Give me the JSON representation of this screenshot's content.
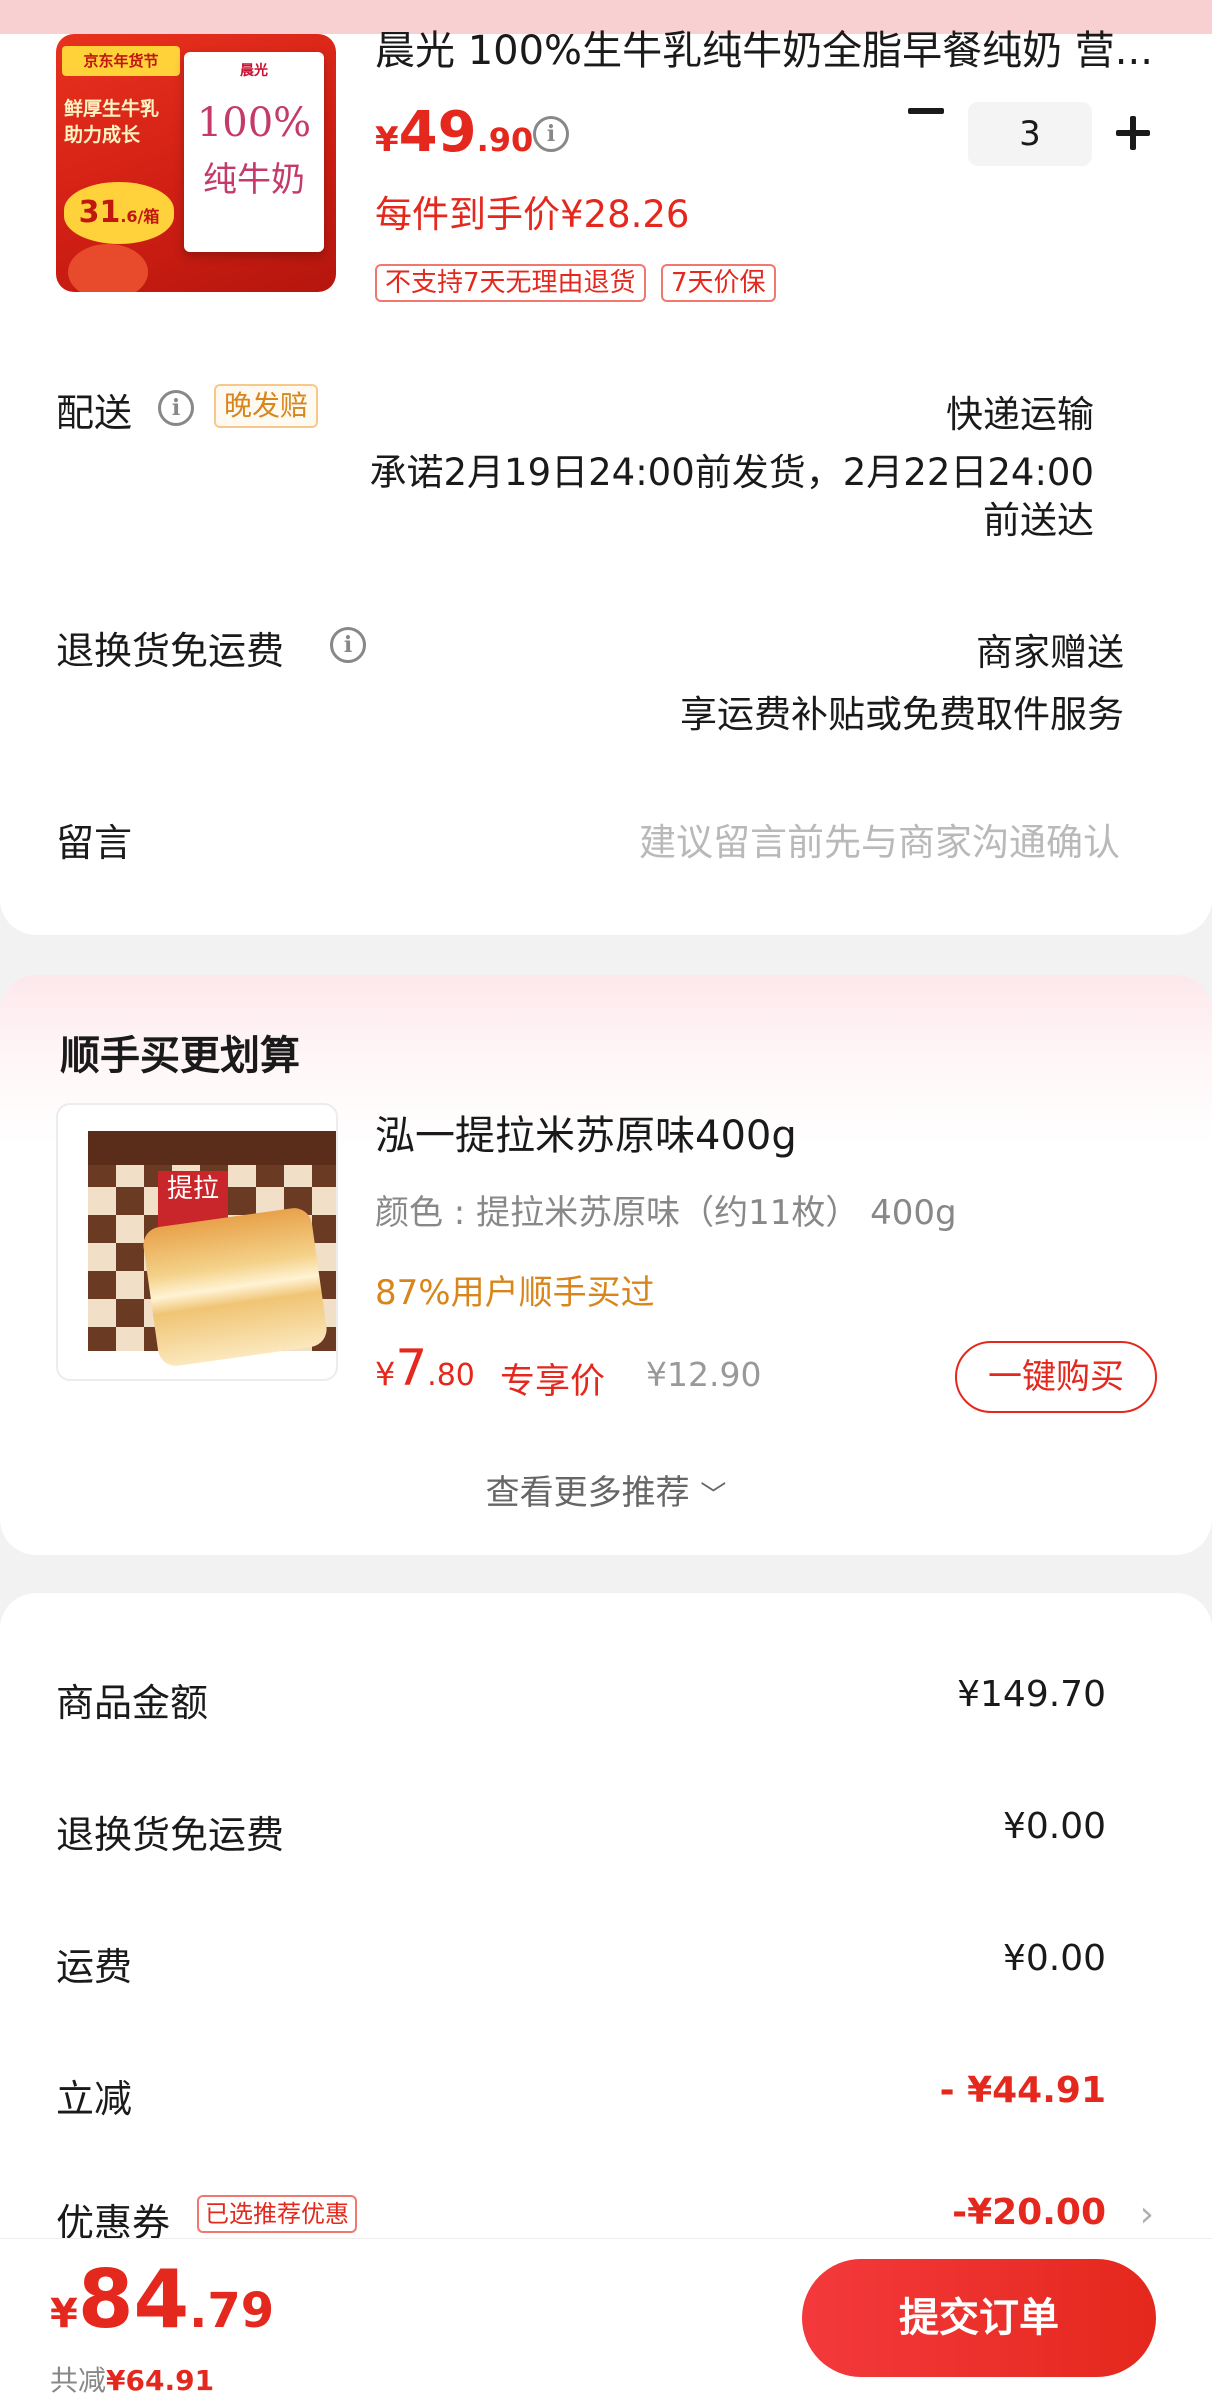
{
  "product": {
    "title": "晨光 100%生牛乳纯牛奶全脂早餐纯奶 营...",
    "price_yen": "¥",
    "price_int": "49",
    "price_dec": ".90",
    "quantity": "3",
    "per_item_price": "每件到手价¥28.26",
    "tags": [
      "不支持7天无理由退货",
      "7天价保"
    ],
    "image": {
      "year_tag": "京东年货节",
      "promo": "鲜厚生牛乳 助力成长",
      "badge_int": "31",
      "badge_dec": ".6/箱",
      "box_brand": "晨光",
      "box_text_1": "100%",
      "box_text_2": "纯牛奶"
    }
  },
  "delivery": {
    "label": "配送",
    "late_tag": "晚发赔",
    "method": "快递运输",
    "promise_line1": "承诺2月19日24:00前发货，2月22日24:00",
    "promise_line2": "前送达"
  },
  "return_shipping": {
    "label": "退换货免运费",
    "value_line1": "商家赠送",
    "value_line2": "享运费补贴或免费取件服务"
  },
  "message": {
    "label": "留言",
    "placeholder": "建议留言前先与商家沟通确认"
  },
  "recommend": {
    "section_title": "顺手买更划算",
    "item_title": "泓一提拉米苏原味400g",
    "spec": "颜色 : 提拉米苏原味（约11枚） 400g",
    "bought": "87%用户顺手买过",
    "price_yen": "¥",
    "price_int": "7",
    "price_dec": ".80",
    "exclusive_label": "专享价",
    "original_price": "¥12.90",
    "buy_button": "一键购买",
    "more": "查看更多推荐",
    "image_label": "提拉"
  },
  "summary": {
    "rows": [
      {
        "label": "商品金额",
        "value": "¥149.70"
      },
      {
        "label": "退换货免运费",
        "value": "¥0.00"
      },
      {
        "label": "运费",
        "value": "¥0.00"
      },
      {
        "label": "立减",
        "value": "- ¥44.91"
      },
      {
        "label": "优惠券",
        "value": "-¥20.00"
      }
    ],
    "coupon_tag": "已选推荐优惠"
  },
  "footer": {
    "total_yen": "¥",
    "total_int": "84",
    "total_dec": ".79",
    "saved_label": "共减",
    "saved_amount": "¥64.91",
    "submit": "提交订单"
  },
  "colors": {
    "accent_red": "#e4281d",
    "orange_text": "#d8861c",
    "muted": "#888888"
  }
}
